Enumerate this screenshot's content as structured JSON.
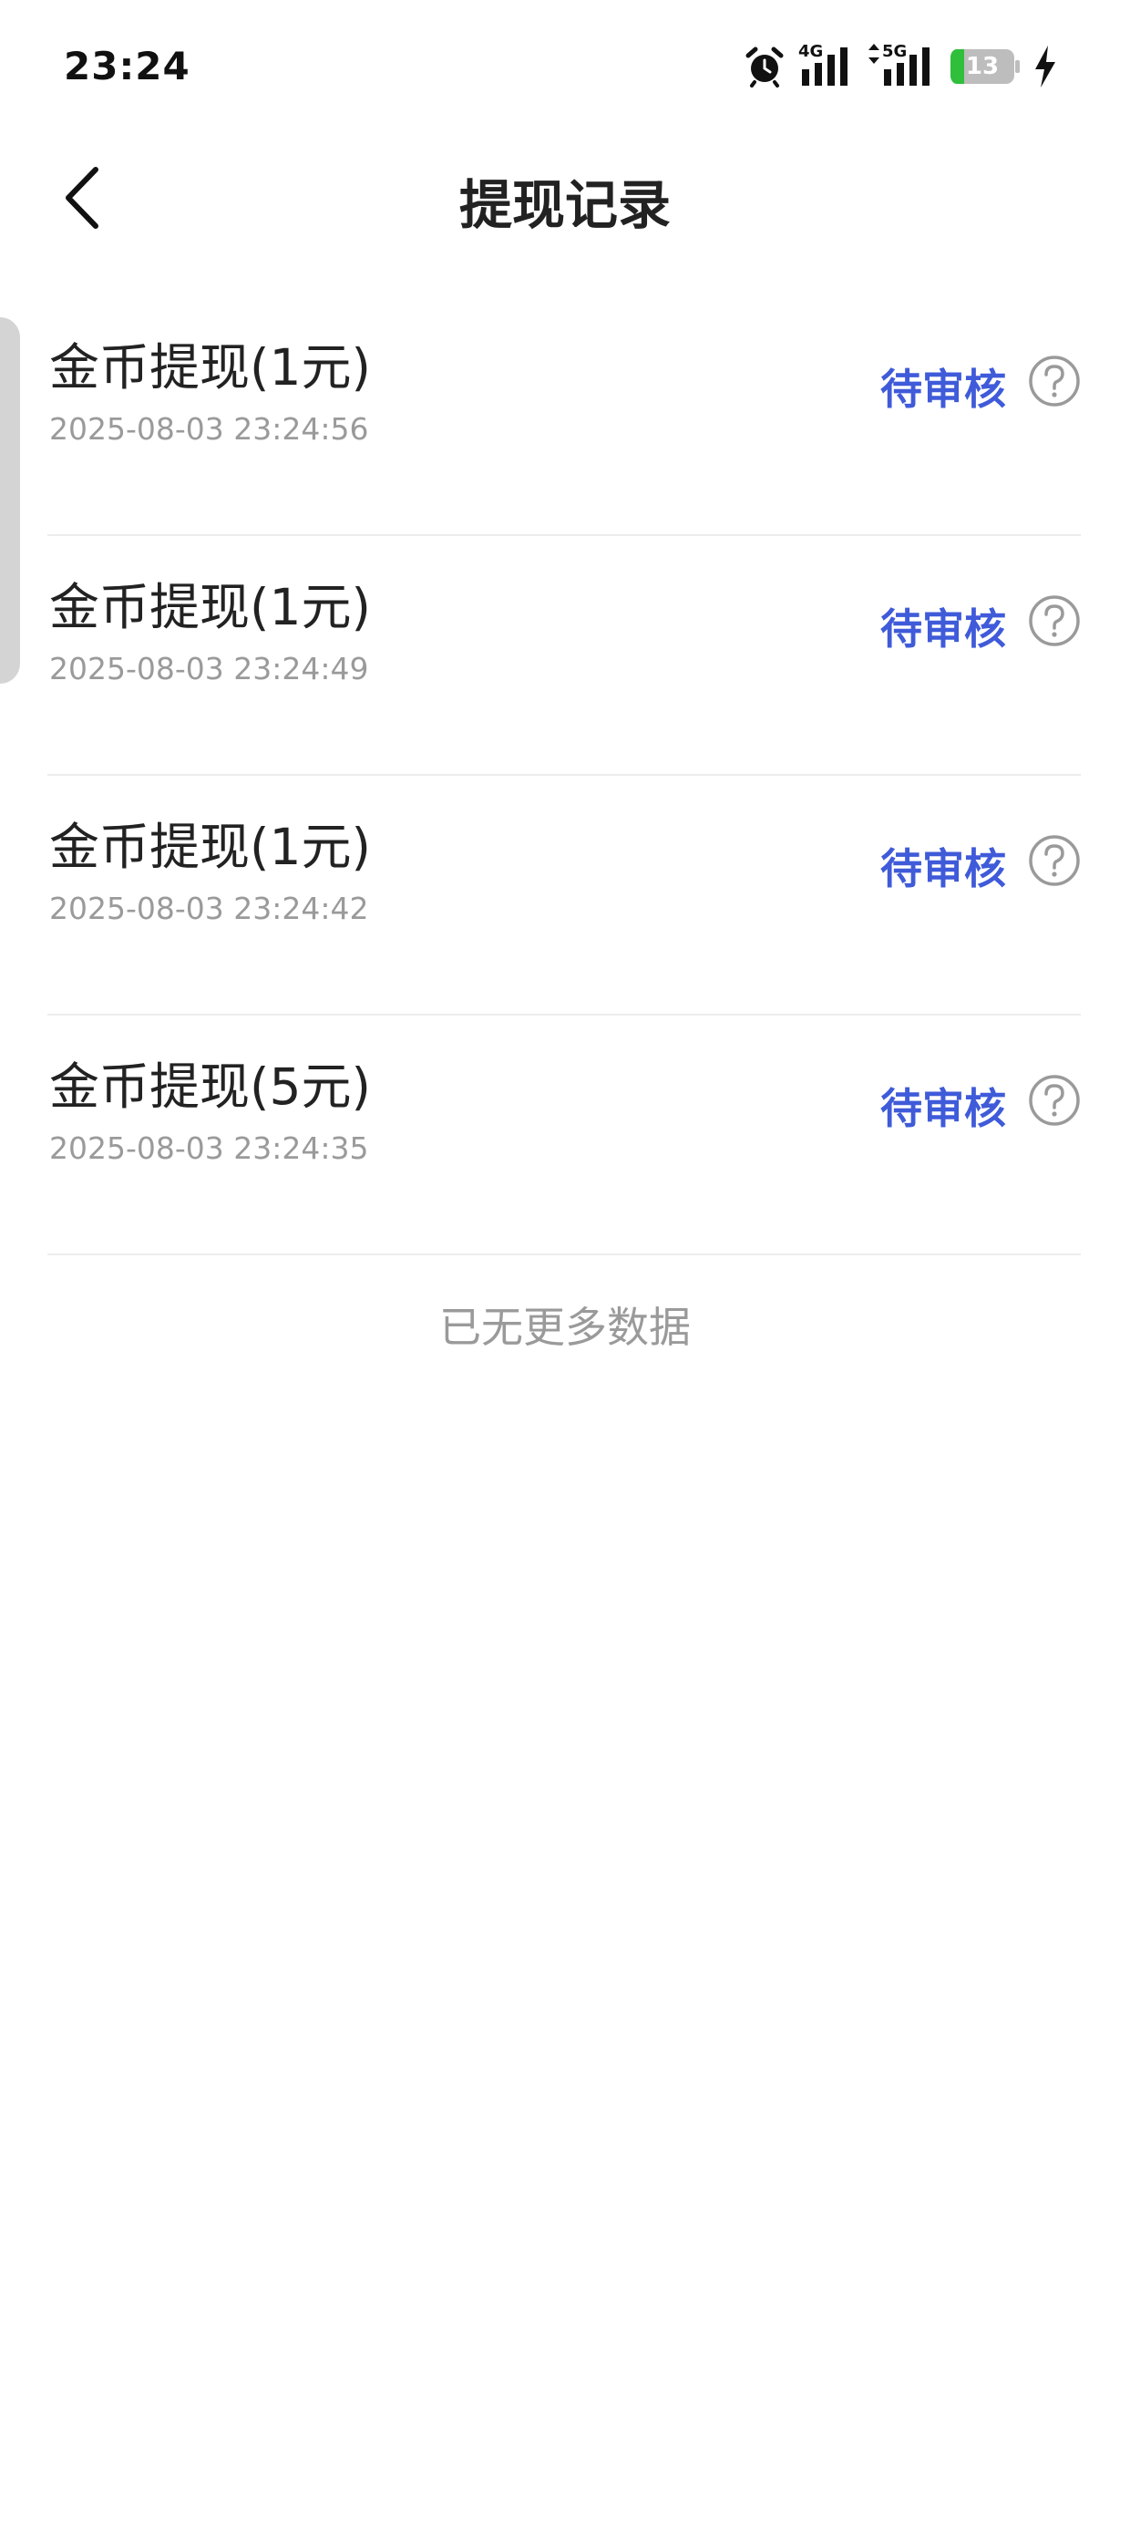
{
  "status_bar": {
    "time": "23:24",
    "network_4g": "4G",
    "network_5g": "5G",
    "battery_level": "13",
    "icons": [
      "alarm-icon",
      "signal-4g-icon",
      "signal-5g-icon",
      "battery-icon",
      "charging-icon"
    ]
  },
  "nav": {
    "title": "提现记录",
    "back_icon": "chevron-left-icon"
  },
  "records": [
    {
      "title": "金币提现(1元)",
      "time": "2025-08-03 23:24:56",
      "status": "待审核"
    },
    {
      "title": "金币提现(1元)",
      "time": "2025-08-03 23:24:49",
      "status": "待审核"
    },
    {
      "title": "金币提现(1元)",
      "time": "2025-08-03 23:24:42",
      "status": "待审核"
    },
    {
      "title": "金币提现(5元)",
      "time": "2025-08-03 23:24:35",
      "status": "待审核"
    }
  ],
  "footer": {
    "no_more": "已无更多数据"
  },
  "colors": {
    "status_blue": "#3f5bd9",
    "battery_green": "#2fbf3a",
    "text_primary": "#222222",
    "text_secondary": "#9a9a9a"
  }
}
